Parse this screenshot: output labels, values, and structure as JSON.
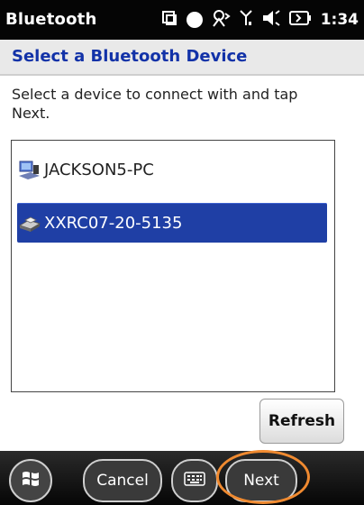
{
  "statusbar": {
    "app_title": "Bluetooth",
    "time": "1:34",
    "icons": [
      "sync-icon",
      "status-circle-icon",
      "bluetooth-person-icon",
      "signal-icon",
      "speaker-icon",
      "battery-icon"
    ]
  },
  "header": {
    "title": "Select a Bluetooth Device"
  },
  "instruction": "Select a device to connect with and tap Next.",
  "devices": [
    {
      "label": "JACKSON5-PC",
      "icon": "computer-icon",
      "selected": false
    },
    {
      "label": "XXRC07-20-5135",
      "icon": "printer-icon",
      "selected": true
    }
  ],
  "buttons": {
    "refresh": "Refresh"
  },
  "softkeys": {
    "cancel": "Cancel",
    "next": "Next"
  },
  "colors": {
    "header_text": "#1232a8",
    "selection": "#1f3fa5",
    "highlight_ring": "#f08a30"
  }
}
